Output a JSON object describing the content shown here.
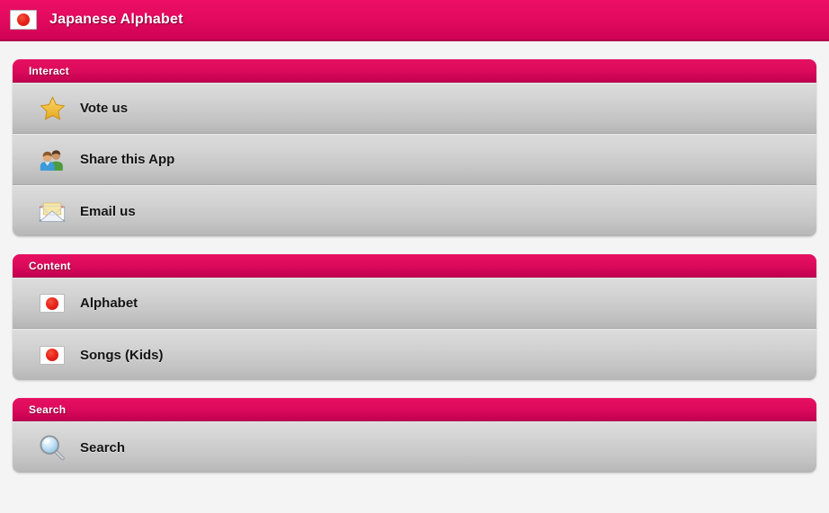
{
  "appbar": {
    "title": "Japanese Alphabet",
    "icon": "japan-flag-icon",
    "accent_top": "#ec0f65",
    "accent_bottom": "#cf0356"
  },
  "colors": {
    "accent": "#e30a5f",
    "accent_dark": "#c20050",
    "page_background": "#f4f4f4",
    "row_top": "#dcdcdc",
    "row_bottom": "#b6b6b6",
    "label": "#141414",
    "header_label": "#ffffff"
  },
  "groups": [
    {
      "header": "Interact",
      "rows": [
        {
          "label": "Vote us",
          "icon": "star-icon"
        },
        {
          "label": "Share this App",
          "icon": "two-people-icon"
        },
        {
          "label": "Email us",
          "icon": "envelope-icon"
        }
      ]
    },
    {
      "header": "Content",
      "rows": [
        {
          "label": "Alphabet",
          "icon": "japan-flag-icon"
        },
        {
          "label": "Songs (Kids)",
          "icon": "japan-flag-icon"
        }
      ]
    },
    {
      "header": "Search",
      "rows": [
        {
          "label": "Search",
          "icon": "magnifier-icon"
        }
      ]
    }
  ]
}
